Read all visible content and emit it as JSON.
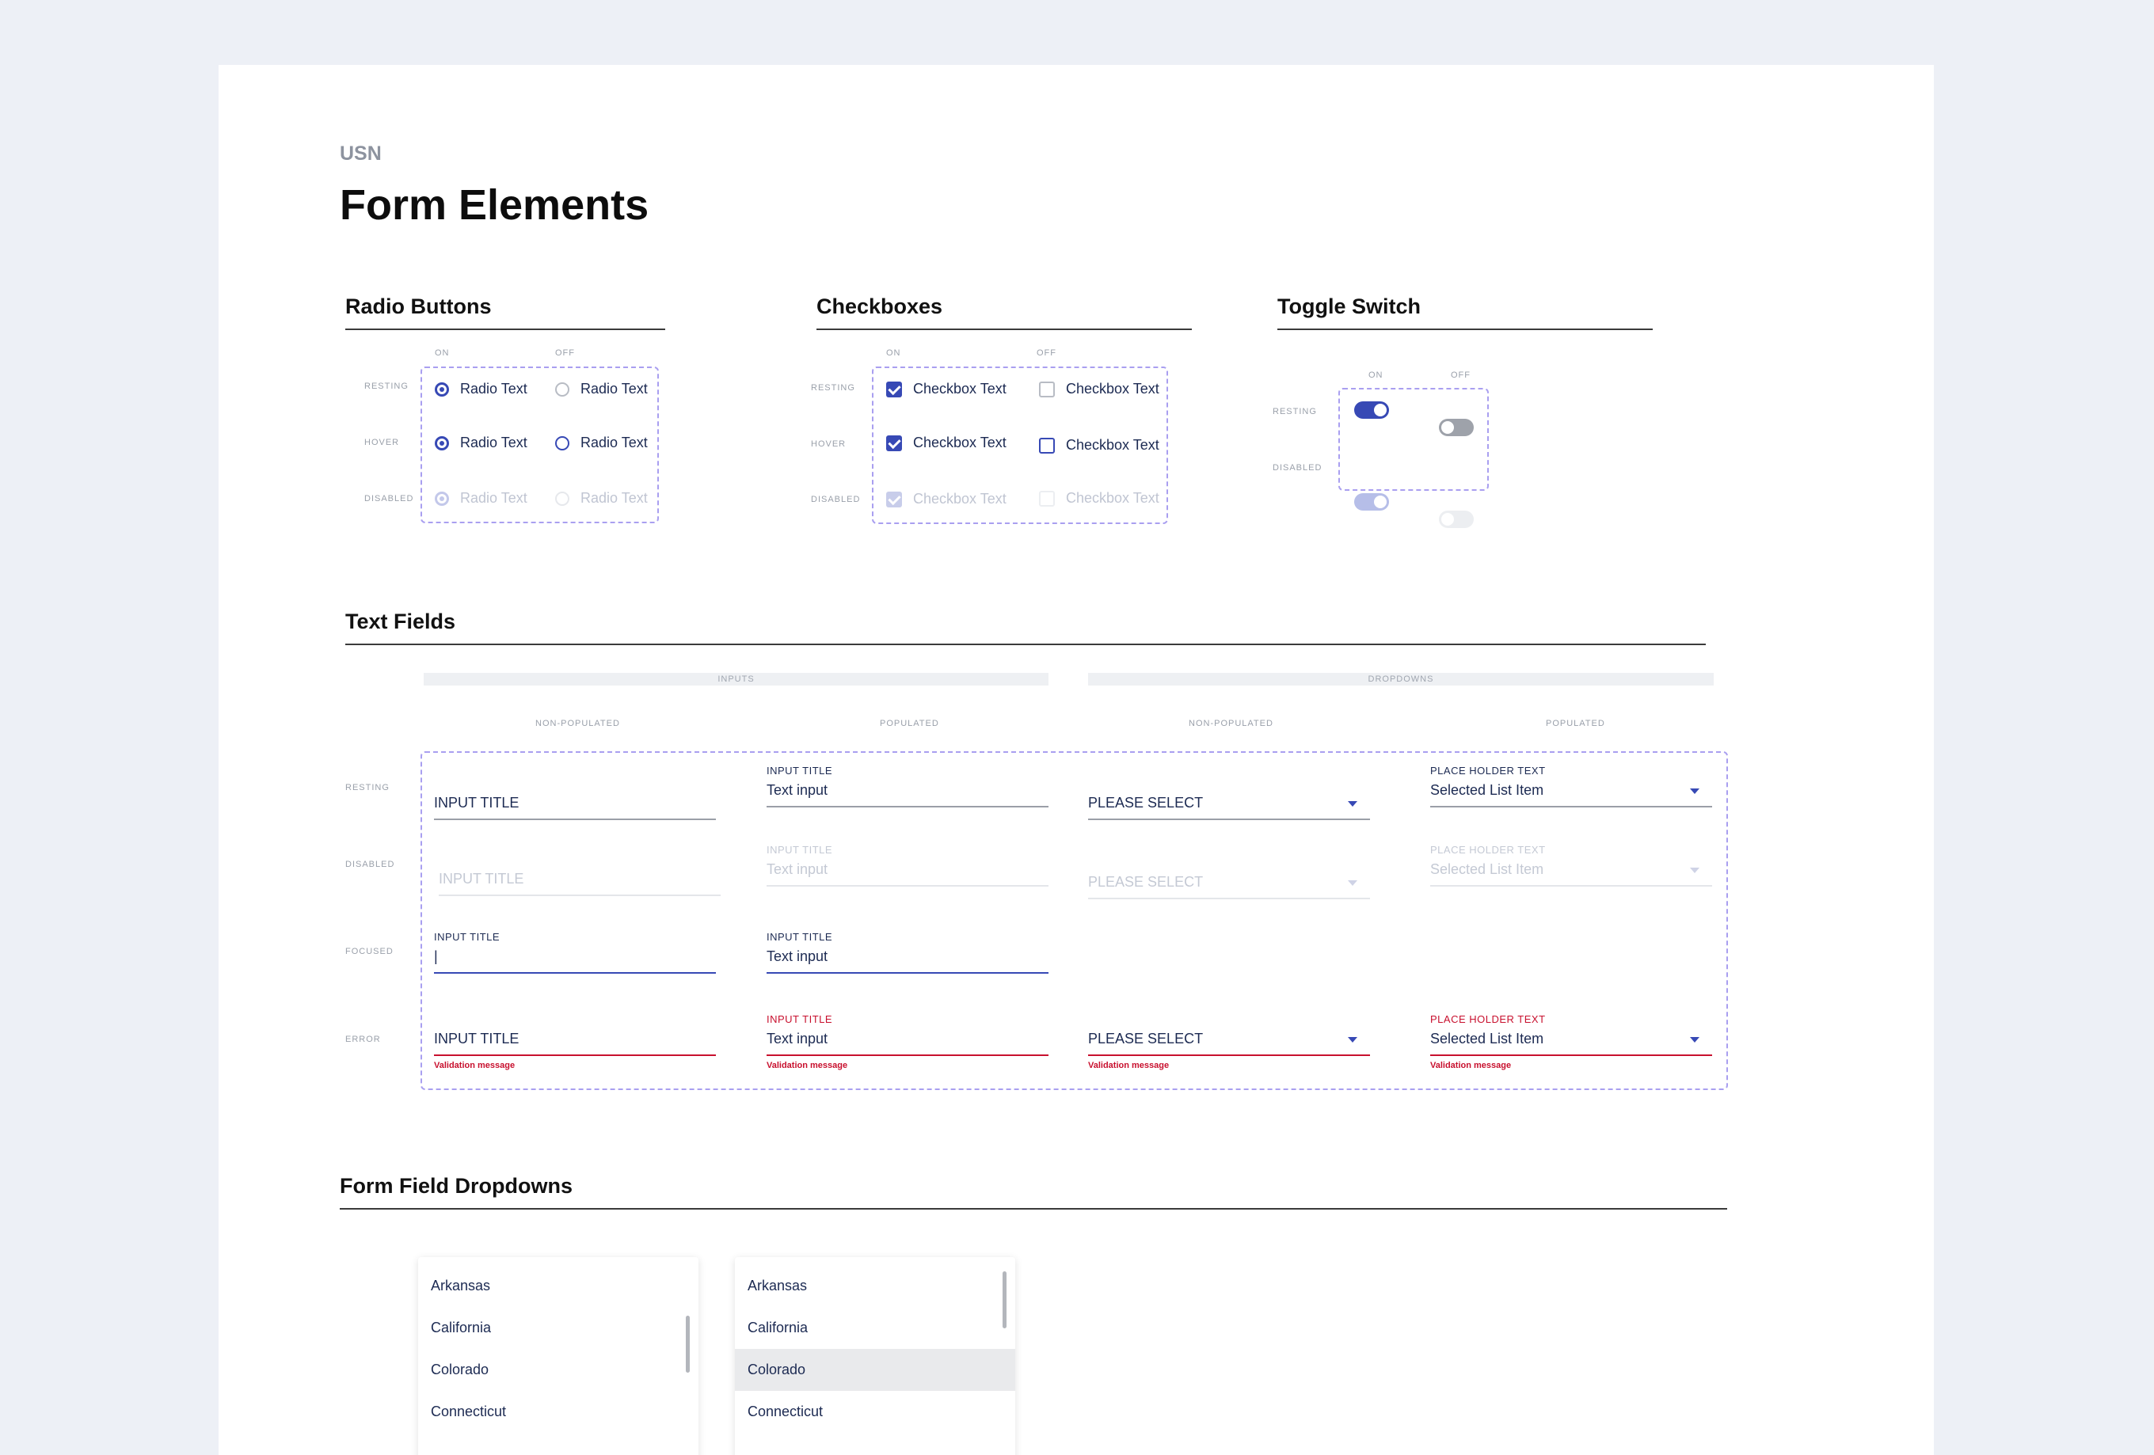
{
  "brand": "USN",
  "title": "Form Elements",
  "radio": {
    "title": "Radio Buttons",
    "col_on": "ON",
    "col_off": "OFF",
    "row_labels": [
      "RESTING",
      "HOVER",
      "DISABLED"
    ],
    "text": "Radio Text"
  },
  "checkbox": {
    "title": "Checkboxes",
    "col_on": "ON",
    "col_off": "OFF",
    "row_labels": [
      "RESTING",
      "HOVER",
      "DISABLED"
    ],
    "text": "Checkbox Text"
  },
  "toggle": {
    "title": "Toggle Switch",
    "col_on": "ON",
    "col_off": "OFF",
    "row_labels": [
      "RESTING",
      "DISABLED"
    ]
  },
  "textfields": {
    "title": "Text Fields",
    "band_inputs": "INPUTS",
    "band_dropdowns": "DROPDOWNS",
    "col_labels": [
      "NON-POPULATED",
      "POPULATED",
      "NON-POPULATED",
      "POPULATED"
    ],
    "row_labels": [
      "RESTING",
      "DISABLED",
      "FOCUSED",
      "ERROR"
    ],
    "input_title": "INPUT TITLE",
    "text_input": "Text input",
    "please_select": "PLEASE SELECT",
    "placeholder_text": "PLACE HOLDER TEXT",
    "selected_item": "Selected List Item",
    "cursor": "|",
    "validation": "Validation message"
  },
  "dropdowns": {
    "title": "Form Field Dropdowns",
    "items": [
      "Arkansas",
      "California",
      "Colorado",
      "Connecticut"
    ]
  },
  "colors": {
    "accent": "#3749b5",
    "error": "#c8102e",
    "dashed": "#a99ff0"
  }
}
